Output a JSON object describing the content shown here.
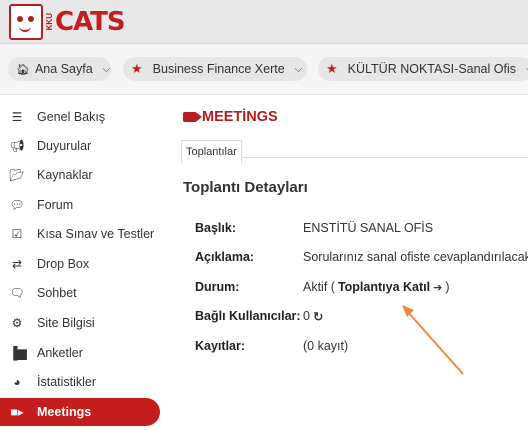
{
  "logo": {
    "text": "CATS",
    "sub": "KKU"
  },
  "nav": {
    "home": "Ana Sayfa",
    "course1": "Business Finance Xerte",
    "course2": "KÜLTÜR NOKTASI-Sanal Ofis"
  },
  "sidebar": {
    "items": [
      {
        "label": "Genel Bakış",
        "icon": "list-icon"
      },
      {
        "label": "Duyurular",
        "icon": "bullhorn-icon"
      },
      {
        "label": "Kaynaklar",
        "icon": "folder-icon"
      },
      {
        "label": "Forum",
        "icon": "comments-icon"
      },
      {
        "label": "Kısa Sınav ve Testler",
        "icon": "check-square-icon"
      },
      {
        "label": "Drop Box",
        "icon": "exchange-icon"
      },
      {
        "label": "Sohbet",
        "icon": "chat-icon"
      },
      {
        "label": "Site Bilgisi",
        "icon": "gear-icon"
      },
      {
        "label": "Anketler",
        "icon": "bar-chart-icon"
      },
      {
        "label": "İstatistikler",
        "icon": "pie-chart-icon"
      },
      {
        "label": "Meetings",
        "icon": "video-camera-icon"
      }
    ],
    "active": "Meetings"
  },
  "main": {
    "title": "MEETİNGS",
    "tab": "Toplantılar",
    "section_title": "Toplantı Detayları",
    "fields": [
      {
        "label": "Başlık:",
        "value": "ENSTİTÜ SANAL OFİS"
      },
      {
        "label": "Açıklama:",
        "value": "Sorularınız sanal ofiste cevaplandırılacaktır."
      },
      {
        "label": "Durum:",
        "value_prefix": "Aktif (",
        "join_label": "Toplantıya Katıl",
        "value_suffix": ")"
      },
      {
        "label": "Bağlı Kullanıcılar:",
        "value": "0"
      },
      {
        "label": "Kayıtlar:",
        "value": "(0 kayıt)"
      }
    ]
  },
  "colors": {
    "brand": "#c41d1d",
    "annotation_arrow": "#f0883e"
  }
}
